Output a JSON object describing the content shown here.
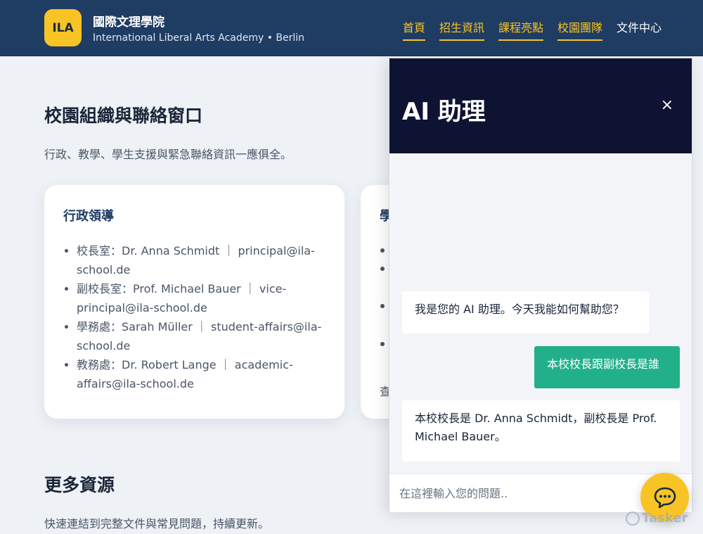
{
  "header": {
    "logo_text": "ILA",
    "title": "國際文理學院",
    "subtitle": "International Liberal Arts Academy • Berlin",
    "nav": [
      {
        "label": "首頁"
      },
      {
        "label": "招生資訊"
      },
      {
        "label": "課程亮點"
      },
      {
        "label": "校園團隊"
      },
      {
        "label": "文件中心"
      }
    ]
  },
  "main": {
    "section_title": "校園組織與聯絡窗口",
    "section_desc": "行政、教學、學生支援與緊急聯絡資訊一應俱全。",
    "card1": {
      "title": "行政領導",
      "items": [
        "校長室：Dr. Anna Schmidt ｜ principal@ila-school.de",
        "副校長室：Prof. Michael Bauer ｜ vice-principal@ila-school.de",
        "學務處：Sarah Müller ｜ student-affairs@ila-school.de",
        "教務處：Dr. Robert Lange ｜ academic-affairs@ila-school.de"
      ]
    },
    "card2": {
      "title": "學",
      "more": "查"
    },
    "section2_title": "更多資源",
    "section2_desc": "快速連結到完整文件與常見問題，持續更新。"
  },
  "chat": {
    "title": "AI 助理",
    "close": "×",
    "messages": [
      {
        "role": "bot",
        "text": "我是您的 AI 助理。今天我能如何幫助您？"
      },
      {
        "role": "user",
        "text": "本校校長跟副校長是誰"
      },
      {
        "role": "bot",
        "text": "本校校長是 Dr. Anna Schmidt，副校長是 Prof. Michael Bauer。"
      }
    ],
    "input_placeholder": "在這裡輸入您的問題.."
  },
  "fab_icon": "chat-bubble-icon",
  "watermark": "Tasker",
  "colors": {
    "header_bg": "#1f3c63",
    "accent": "#f8c425",
    "chat_head_bg": "#0f1333",
    "user_bubble": "#22b08a"
  }
}
